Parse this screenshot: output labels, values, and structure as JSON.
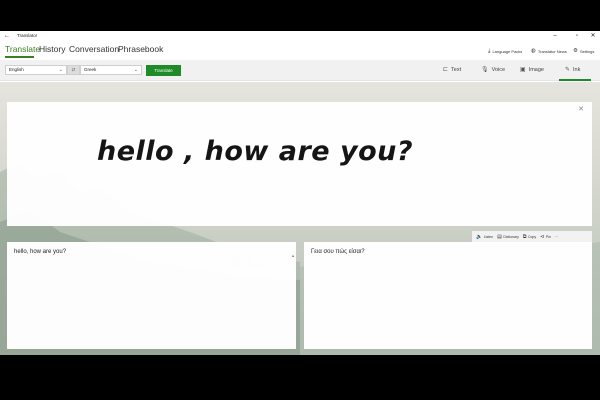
{
  "titlebar": {
    "back_icon": "back-arrow-icon",
    "title": "Translator"
  },
  "nav": {
    "tabs": [
      "Translate",
      "History",
      "Conversation",
      "Phrasebook"
    ],
    "active": "Translate",
    "links": [
      {
        "label": "Language Packs",
        "icon": "download-icon"
      },
      {
        "label": "Translator News",
        "icon": "globe-icon"
      },
      {
        "label": "Settings",
        "icon": "gear-icon"
      }
    ]
  },
  "toolbar": {
    "source_language": "English",
    "target_language": "Greek",
    "translate_label": "Translate",
    "modes": [
      {
        "label": "Text",
        "icon": "text-icon"
      },
      {
        "label": "Voice",
        "icon": "microphone-icon"
      },
      {
        "label": "Image",
        "icon": "image-icon"
      },
      {
        "label": "Ink",
        "icon": "pen-icon"
      }
    ],
    "active_mode": "Ink"
  },
  "ink": {
    "handwriting": "hello , how are you?"
  },
  "actions": [
    {
      "label": "Listen",
      "icon": "speaker-icon"
    },
    {
      "label": "Dictionary",
      "icon": "book-icon"
    },
    {
      "label": "Copy",
      "icon": "copy-icon"
    },
    {
      "label": "Pin",
      "icon": "pin-icon"
    }
  ],
  "source_text": "hello, how are you?",
  "translated_text": "Γεια σου πώς είσαι?",
  "colors": {
    "accent": "#1e8a28",
    "nav_active": "#3a7f22"
  }
}
